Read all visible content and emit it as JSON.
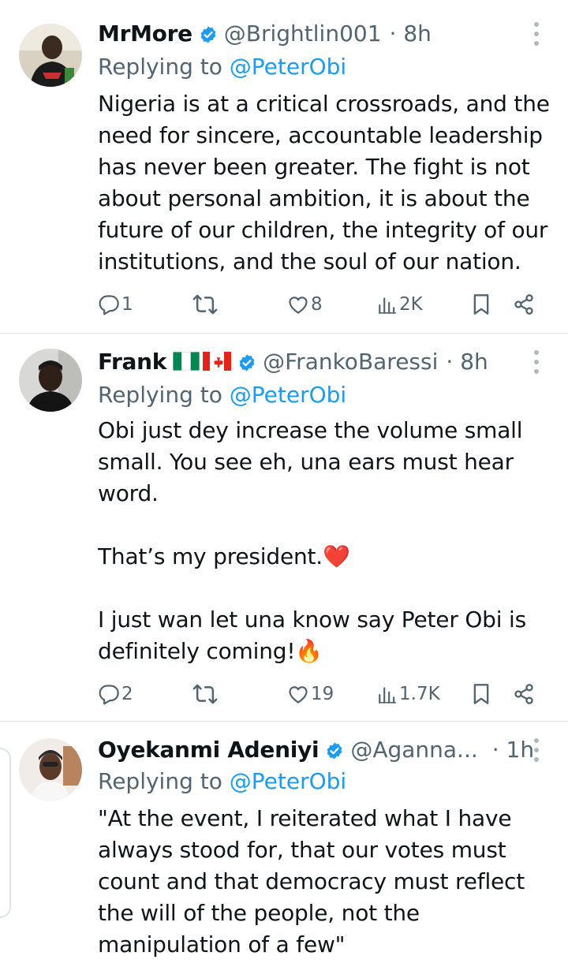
{
  "tweets": [
    {
      "name": "MrMore",
      "handle": "@Brightlin001",
      "time": "· 8h",
      "replying_prefix": "Replying to ",
      "replying_to": "@PeterObi",
      "body": "Nigeria is at a critical crossroads, and the\nneed for sincere, accountable leadership\nhas never been greater. The fight is not\nabout personal ambition, it is about the\nfuture of our children, the integrity of our\ninstitutions, and the soul of our nation.",
      "replies": "1",
      "retweets": "",
      "likes": "8",
      "views": "2K"
    },
    {
      "name": "Frank",
      "handle": "@FrankoBaressi",
      "time": "· 8h",
      "replying_prefix": "Replying to ",
      "replying_to": "@PeterObi",
      "body": "Obi just dey increase the volume small\nsmall. You see eh, una ears must hear\nword.\n\nThat’s my president.❤️\n\nI just wan let una know say Peter Obi is\ndefinitely coming!🔥",
      "replies": "2",
      "retweets": "",
      "likes": "19",
      "views": "1.7K"
    },
    {
      "name": "Oyekanmi Adeniyi",
      "handle": "@Aganna...",
      "time": "· 1h",
      "replying_prefix": "Replying to ",
      "replying_to": "@PeterObi",
      "body": "\"At the event, I reiterated what I have\nalways stood for, that our votes must\ncount and that democracy must reflect\nthe will of the people, not the\nmanipulation of a few\""
    }
  ],
  "icons": {
    "verified": "verified-badge-icon",
    "reply": "reply-icon",
    "retweet": "retweet-icon",
    "like": "heart-icon",
    "views": "views-icon",
    "bookmark": "bookmark-icon",
    "share": "share-icon",
    "more": "more-vertical-icon"
  },
  "colors": {
    "accent": "#1d9bf0",
    "secondary_text": "#536471",
    "divider": "#e4e8ec"
  }
}
